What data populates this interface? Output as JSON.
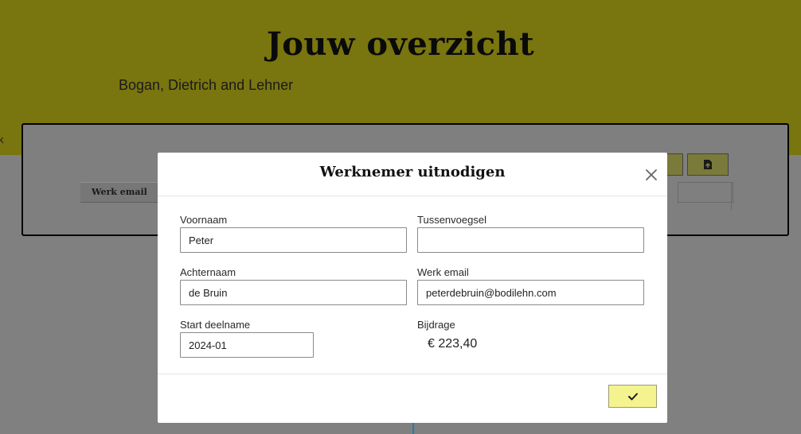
{
  "header": {
    "title": "Jouw overzicht",
    "company": "Bogan, Dietrich and Lehner",
    "back_link": "k"
  },
  "table": {
    "column_header": "Werk email"
  },
  "modal": {
    "title": "Werknemer uitnodigen",
    "fields": {
      "first_name": {
        "label": "Voornaam",
        "value": "Peter"
      },
      "infix": {
        "label": "Tussenvoegsel",
        "value": ""
      },
      "last_name": {
        "label": "Achternaam",
        "value": "de Bruin"
      },
      "work_email": {
        "label": "Werk email",
        "value": "peterdebruin@bodilehn.com"
      },
      "start": {
        "label": "Start deelname",
        "value": "2024-01"
      },
      "contribution": {
        "label": "Bijdrage",
        "value": "€ 223,40"
      }
    }
  },
  "colors": {
    "header_bg": "#79750f",
    "accent_button": "#f5f38f"
  }
}
